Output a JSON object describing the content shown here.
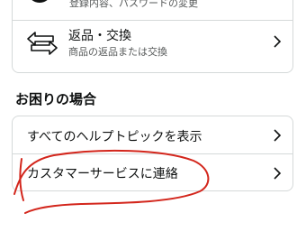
{
  "account_section": {
    "login_row": {
      "subtitle": "登録内容、パスワードの変更",
      "icon": "account-icon"
    },
    "returns_row": {
      "title": "返品・交換",
      "subtitle": "商品の返品または交換",
      "icon": "return-exchange-icon"
    }
  },
  "help_section": {
    "heading": "お困りの場合",
    "items": [
      {
        "label": "すべてのヘルプトピックを表示"
      },
      {
        "label": "カスタマーサービスに連絡"
      }
    ]
  },
  "annotation": {
    "color": "#d3261c",
    "shape": "hand-drawn circle around contact customer service row"
  }
}
